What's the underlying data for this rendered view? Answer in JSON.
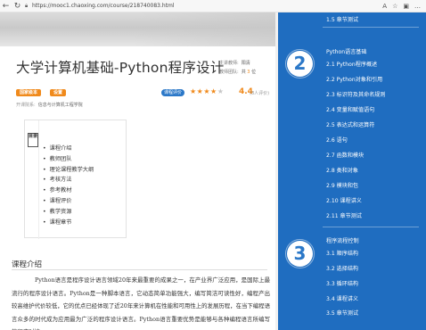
{
  "browser": {
    "url": "https://mooc1.chaoxing.com/course/218740083.html",
    "back_icon": "back-arrow-icon",
    "refresh_icon": "refresh-icon"
  },
  "course": {
    "title": "大学计算机基础-Python程序设计",
    "teacher_label": "主讲教师:",
    "teacher_value": "阳清",
    "count_label": "教师团队:",
    "count_prefix": "共",
    "count_value": "3",
    "count_suffix": "位",
    "tag1": "国家级本",
    "tag2": "设置",
    "rating_badge": "课程评价",
    "score": "4.4",
    "score_note": "(8人评价)",
    "subject_label": "开课院系:",
    "subject_value": "信息与计算机工程学院",
    "star_color": "#f08a1c"
  },
  "toc": {
    "label": "目录",
    "items": [
      "课程介绍",
      "教师团队",
      "理论课程教学大纲",
      "考核方法",
      "参考教材",
      "课程评价",
      "教学资源",
      "课程章节"
    ]
  },
  "intro": {
    "heading": "课程介绍",
    "text": "Python语言是程序设计语言领域20年来最重要的成果之一，在产业界广泛应用，是国际上最流行的程序设计语言。Python是一种脚本语言，它动态简单功能强大，编写简洁可读性好，编程产出较高维护代价较低，它的优点已经体现了近20年来计算机在性能和可用性上的发展历程，在当下编程语言众多的时代成为应用最为广泛的程序设计语言。Python语言重要优势是能够与各种编程语言所编写的程序对接。"
  },
  "sidebar": {
    "accent": "#1f6dc0",
    "top_item": "1.5  章节测试",
    "chapter2_num": "2",
    "chapter2_title": "Python语言基础",
    "chapter2_items": [
      "2.1  Python程序概述",
      "2.2  Python对象和引用",
      "2.3  标识符及其命名规则",
      "2.4  变量和赋值语句",
      "2.5  表达式和运算符",
      "2.6  语句",
      "2.7  函数和模块",
      "2.8  类和对象",
      "2.9  模块和包",
      "2.10  课程讲义",
      "2.11  章节测试"
    ],
    "chapter3_num": "3",
    "chapter3_title": "程序流程控制",
    "chapter3_items": [
      "3.1  顺序结构",
      "3.2  选择结构",
      "3.3  循环结构",
      "3.4  课程讲义",
      "3.5  章节测试"
    ]
  }
}
